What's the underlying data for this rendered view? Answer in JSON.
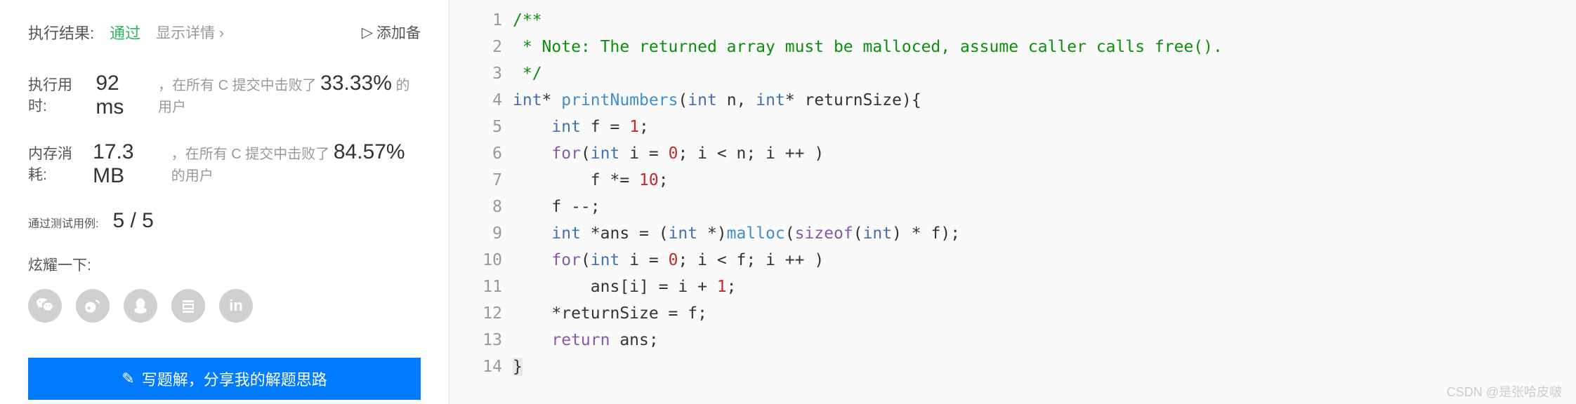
{
  "results": {
    "label": "执行结果:",
    "status": "通过",
    "show_detail": "显示详情 ›",
    "add_note": "添加备"
  },
  "runtime": {
    "label": "执行用时:",
    "value": "92 ms",
    "text1": "，在所有 C 提交中击败了",
    "percent": "33.33%",
    "text2": "的用户"
  },
  "memory": {
    "label": "内存消耗:",
    "value": "17.3 MB",
    "text1": "，在所有 C 提交中击败了",
    "percent": "84.57%",
    "text2": "的用户"
  },
  "testcases": {
    "label": "通过测试用例:",
    "value": "5 / 5"
  },
  "share": {
    "label": "炫耀一下:"
  },
  "writeSolution": "写题解，分享我的解题思路",
  "code": {
    "lines": [
      "1",
      "2",
      "3",
      "4",
      "5",
      "6",
      "7",
      "8",
      "9",
      "10",
      "11",
      "12",
      "13",
      "14"
    ],
    "l1": "/**",
    "l2": " * Note: The returned array must be malloced, assume caller calls free().",
    "l3": " */",
    "l4_int": "int",
    "l4_fn": "printNumbers",
    "l4_p1": "int",
    "l4_n": "n",
    "l4_p2": "int",
    "l4_rs": "returnSize",
    "l5_int": "int",
    "l5_rest": " f = ",
    "l5_n": "1",
    "l6_for": "for",
    "l6_int": "int",
    "l6_rest1": " i = ",
    "l6_n0": "0",
    "l6_rest2": "; i < n; i ++ )",
    "l7_rest": "f *= ",
    "l7_n": "10",
    "l8": "f --;",
    "l9_int": "int",
    "l9_rest1": " *ans = (",
    "l9_int2": "int",
    "l9_rest2": " *)",
    "l9_malloc": "malloc",
    "l9_sizeof": "sizeof",
    "l9_int3": "int",
    "l9_rest3": ") * f);",
    "l10_for": "for",
    "l10_int": "int",
    "l10_rest1": " i = ",
    "l10_n0": "0",
    "l10_rest2": "; i < f; i ++ )",
    "l11_rest1": "ans[i] = i + ",
    "l11_n": "1",
    "l12": "*returnSize = f;",
    "l13_ret": "return",
    "l13_rest": " ans;",
    "l14": "}"
  },
  "watermark": "CSDN @是张哈皮啵"
}
